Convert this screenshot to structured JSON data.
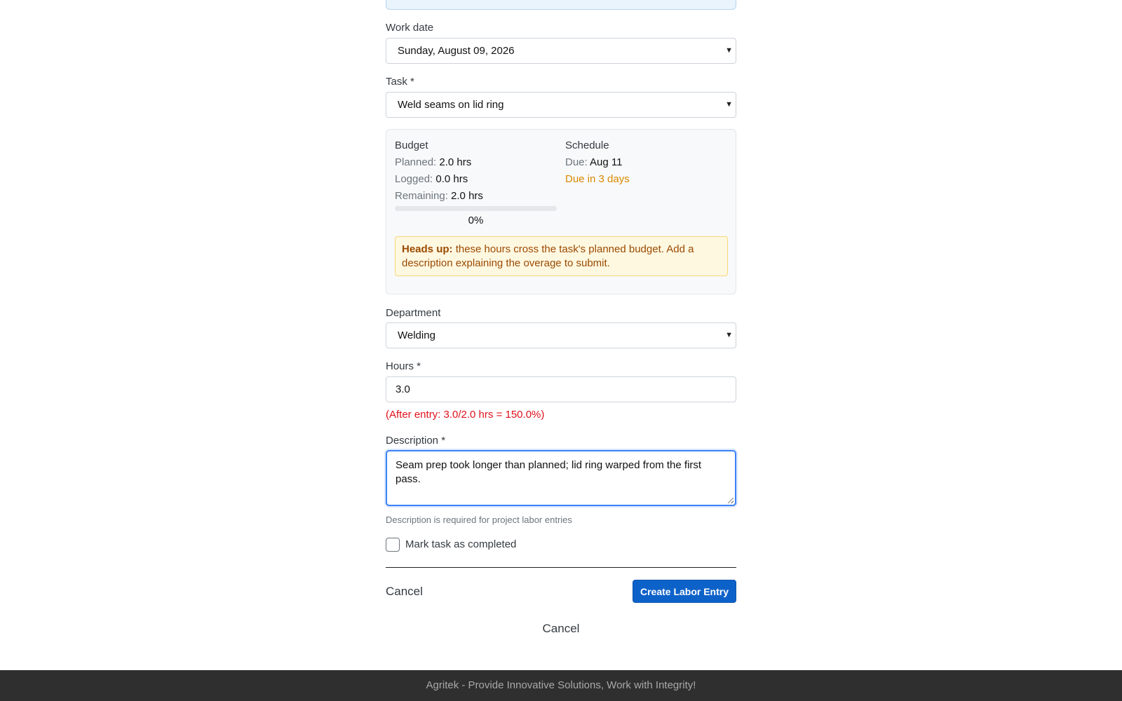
{
  "form": {
    "work_date": {
      "label": "Work date",
      "value": "Sunday, August 09, 2026"
    },
    "task": {
      "label": "Task *",
      "value": "Weld seams on lid ring"
    },
    "budget": {
      "title": "Budget",
      "planned_label": "Planned:",
      "planned_value": "2.0 hrs",
      "logged_label": "Logged:",
      "logged_value": "0.0 hrs",
      "remaining_label": "Remaining:",
      "remaining_value": "2.0 hrs",
      "progress_fraction": 0,
      "progress_text": "0%"
    },
    "schedule": {
      "title": "Schedule",
      "due_label": "Due:",
      "due_value": "Aug 11",
      "due_status": "Due in 3 days"
    },
    "warning": {
      "strong": "Heads up:",
      "text": "these hours cross the task's planned budget. Add a description explaining the overage to submit."
    },
    "department": {
      "label": "Department",
      "value": "Welding"
    },
    "hours": {
      "label": "Hours *",
      "value": "3.0",
      "after_entry": "(After entry: 3.0/2.0 hrs = 150.0%)"
    },
    "description": {
      "label": "Description *",
      "value": "Seam prep took longer than planned; lid ring warped from the first pass.",
      "help": "Description is required for project labor entries"
    },
    "mark_completed": {
      "label": "Mark task as completed",
      "checked": false
    },
    "actions": {
      "cancel": "Cancel",
      "submit": "Create Labor Entry",
      "cancel_bottom": "Cancel"
    }
  },
  "footer": {
    "text": "Agritek - Provide Innovative Solutions, Work with Integrity!"
  },
  "colors": {
    "primary": "#0d62c9",
    "warning_bg": "#fff8e1",
    "warning_text": "#9a4a00",
    "error": "#e0101b",
    "due_soon": "#d98a00",
    "footer_bg": "#2f2f2f"
  },
  "icons": {
    "select_chevron": "chevron-down-icon",
    "resize": "resize-grip-icon"
  }
}
